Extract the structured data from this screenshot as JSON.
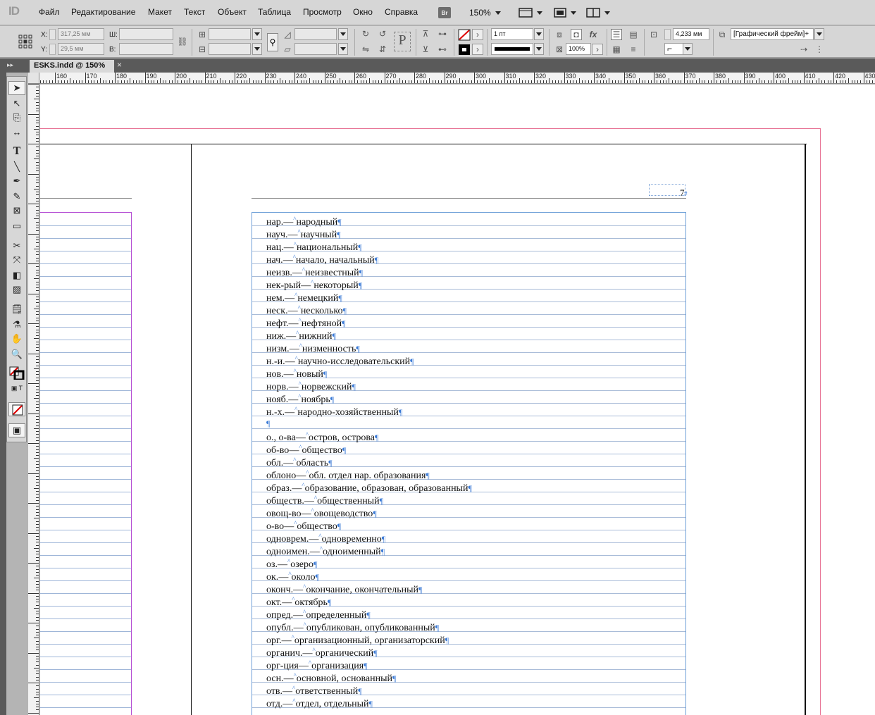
{
  "app": {
    "logo": "ID"
  },
  "menu": [
    "Файл",
    "Редактирование",
    "Макет",
    "Текст",
    "Объект",
    "Таблица",
    "Просмотр",
    "Окно",
    "Справка"
  ],
  "menubar_controls": {
    "bridge": "Br",
    "zoom": "150%"
  },
  "control": {
    "x_label": "X:",
    "x_value": "317,25 мм",
    "y_label": "Y:",
    "y_value": "29,5 мм",
    "w_label": "Ш:",
    "h_label": "В:",
    "stroke_weight": "1 пт",
    "opacity": "100%",
    "dimension": "4,233 мм",
    "frame_style": "[Графический фрейм]+"
  },
  "tab": {
    "title": "ESKS.indd @ 150%"
  },
  "ruler": {
    "h_labels": [
      "160",
      "170",
      "180",
      "190",
      "200",
      "210",
      "220",
      "230",
      "240",
      "250",
      "260",
      "270",
      "280",
      "290",
      "300",
      "310",
      "320",
      "330",
      "340",
      "350",
      "360",
      "370",
      "380",
      "390",
      "400",
      "410",
      "420",
      "430"
    ]
  },
  "page": {
    "number": "7"
  },
  "entries": [
    {
      "abbr": "нар.",
      "full": "народный"
    },
    {
      "abbr": "науч.",
      "full": "научный"
    },
    {
      "abbr": "нац.",
      "full": "национальный"
    },
    {
      "abbr": "нач.",
      "full": "начало, начальный"
    },
    {
      "abbr": "неизв.",
      "full": "неизвестный"
    },
    {
      "abbr": "нек-рый",
      "full": "некоторый"
    },
    {
      "abbr": "нем.",
      "full": "немецкий"
    },
    {
      "abbr": "неск.",
      "full": "несколько"
    },
    {
      "abbr": "нефт.",
      "full": "нефтяной"
    },
    {
      "abbr": "ниж.",
      "full": "нижний"
    },
    {
      "abbr": "низм.",
      "full": "низменность"
    },
    {
      "abbr": "н.-и.",
      "full": "научно-исследовательский"
    },
    {
      "abbr": "нов.",
      "full": "новый"
    },
    {
      "abbr": "норв.",
      "full": "норвежский"
    },
    {
      "abbr": "нояб.",
      "full": "ноябрь"
    },
    {
      "abbr": "н.-х.",
      "full": "народно-хозяйственный"
    },
    {
      "abbr": "",
      "full": ""
    },
    {
      "abbr": "о., о-ва",
      "full": "остров, острова"
    },
    {
      "abbr": "об-во",
      "full": "общество"
    },
    {
      "abbr": "обл.",
      "full": "область"
    },
    {
      "abbr": "облоно",
      "full": "обл. отдел нар. образования"
    },
    {
      "abbr": "образ.",
      "full": "образование, образован, образованный"
    },
    {
      "abbr": "обществ.",
      "full": "общественный"
    },
    {
      "abbr": "овощ-во",
      "full": "овощеводство"
    },
    {
      "abbr": "о-во",
      "full": "общество"
    },
    {
      "abbr": "одноврем.",
      "full": "одновременно"
    },
    {
      "abbr": "одноимен.",
      "full": "одноименный"
    },
    {
      "abbr": "оз.",
      "full": "озеро"
    },
    {
      "abbr": "ок.",
      "full": "около"
    },
    {
      "abbr": "оконч.",
      "full": "окончание, окончательный"
    },
    {
      "abbr": "окт.",
      "full": "октябрь"
    },
    {
      "abbr": "опред.",
      "full": "определенный"
    },
    {
      "abbr": "опубл.",
      "full": "опубликован, опубликованный"
    },
    {
      "abbr": "орг.",
      "full": "организационный, организаторский"
    },
    {
      "abbr": "органич.",
      "full": "органический"
    },
    {
      "abbr": "орг-ция",
      "full": "организация"
    },
    {
      "abbr": "осн.",
      "full": "основной, основанный"
    },
    {
      "abbr": "отв.",
      "full": "ответственный"
    },
    {
      "abbr": "отд.",
      "full": "отдел, отдельный"
    }
  ],
  "markers": {
    "pilcrow": "¶",
    "dash": "—",
    "space": "^"
  },
  "colors": {
    "bleed": "#e87596",
    "frame": "#6fa0d8",
    "margin_left": "#b44cd3"
  }
}
